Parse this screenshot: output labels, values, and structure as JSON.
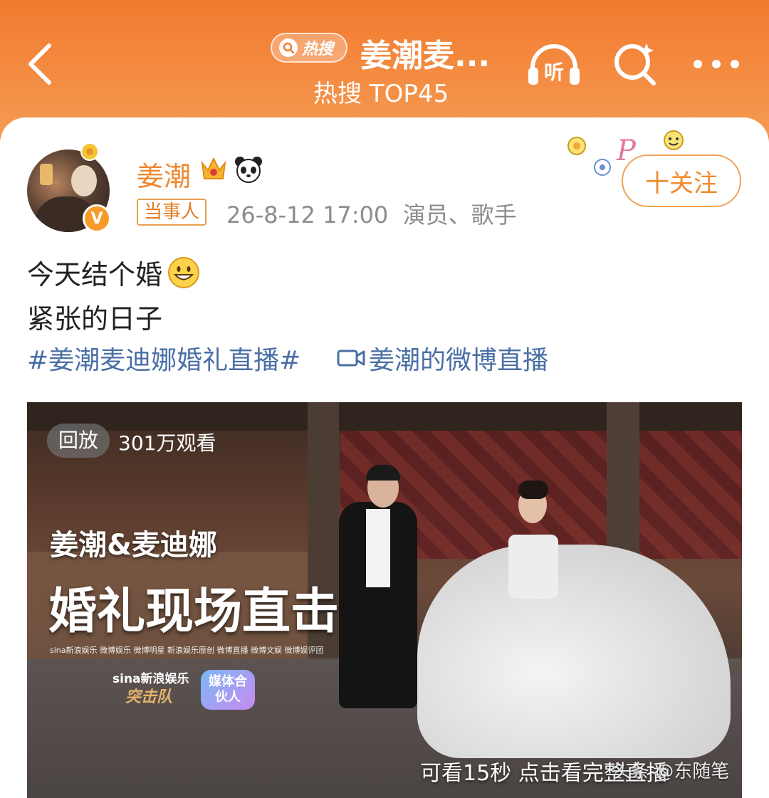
{
  "header": {
    "hot_badge": "热搜",
    "topic_title": "姜潮麦...",
    "topic_subtitle": "热搜 TOP45",
    "listen_label": "听"
  },
  "post": {
    "author": "姜潮",
    "role_tag": "当事人",
    "timestamp": "26-8-12 17:00",
    "author_desc": "演员、歌手",
    "verified_mark": "V",
    "follow_label": "十关注",
    "text_line1": "今天结个婚",
    "text_line2": "紧张的日子",
    "hashtag": "#姜潮麦迪娜婚礼直播#",
    "live_link": "姜潮的微博直播"
  },
  "video": {
    "replay_badge": "回放",
    "view_count": "301万观看",
    "title_line1": "姜潮&麦迪娜",
    "title_line2": "婚礼现场直击",
    "sponsors": "sina新浪娱乐  微博娱乐  微博明星  新浪娱乐原创  微博直播  微博文娱  微博娱评团",
    "sina_brand": "sina新浪娱乐",
    "sina_sub": "突击队",
    "media_badge": "媒体合伙人",
    "preview_note": "可看15秒 点击看完整直播",
    "watermark": "头条 @东随笔"
  },
  "colors": {
    "header_orange": "#f27a2e",
    "username_orange": "#f0882e",
    "link_blue": "#4a6fa5",
    "meta_gray": "#8c8c8c"
  }
}
